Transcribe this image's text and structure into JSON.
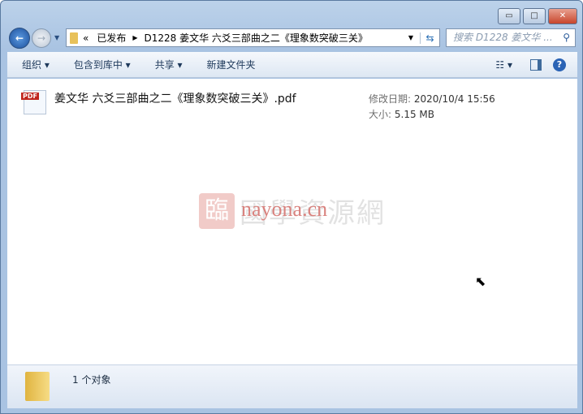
{
  "window": {
    "minimize": "▭",
    "maximize": "□",
    "close": "✕"
  },
  "nav": {
    "back": "←",
    "forward": "→"
  },
  "address": {
    "chevrons": "«",
    "crumbs": [
      "已发布",
      "D1228 姜文华 六爻三部曲之二《理象数突破三关》"
    ]
  },
  "search": {
    "placeholder": "搜索 D1228 姜文华 ..."
  },
  "toolbar": {
    "organize": "组织 ▾",
    "include": "包含到库中 ▾",
    "share": "共享 ▾",
    "new_folder": "新建文件夹"
  },
  "file": {
    "name": "姜文华 六爻三部曲之二《理象数突破三关》.pdf",
    "modified_label": "修改日期:",
    "modified": "2020/10/4 15:56",
    "size_label": "大小:",
    "size": "5.15 MB",
    "icon": "pdf-icon",
    "icon_text": "PDF"
  },
  "watermark": {
    "text": "nayona.cn",
    "cn": "國學資源網",
    "logo": "臨"
  },
  "status": {
    "count": "1 个对象"
  }
}
